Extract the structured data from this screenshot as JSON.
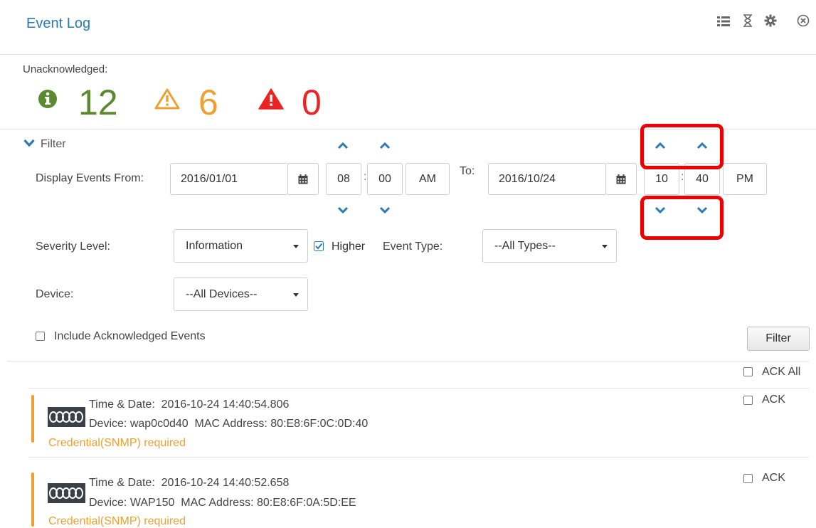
{
  "header": {
    "title": "Event Log",
    "icons": [
      "list-icon",
      "hourglass-icon",
      "gear-icon",
      "close-icon"
    ]
  },
  "unacknowledged": {
    "label": "Unacknowledged:",
    "info_count": "12",
    "warning_count": "6",
    "alert_count": "0",
    "colors": {
      "info": "#5a8a2f",
      "warning": "#f0a030",
      "alert": "#ee2222"
    }
  },
  "filter": {
    "toggle_label": "Filter",
    "from_label": "Display Events From:",
    "from_date": "2016/01/01",
    "from_hour": "08",
    "from_minute": "00",
    "from_ampm": "AM",
    "to_label": "To:",
    "to_date": "2016/10/24",
    "to_hour": "10",
    "to_minute": "40",
    "to_ampm": "PM",
    "severity_label": "Severity Level:",
    "severity_value": "Information",
    "higher_label": "Higher",
    "higher_checked": true,
    "event_type_label": "Event Type:",
    "event_type_value": "--All Types--",
    "device_label": "Device:",
    "device_value": "--All Devices--",
    "include_ack_label": "Include Acknowledged Events",
    "filter_button": "Filter"
  },
  "list": {
    "ack_all_label": "ACK All",
    "events": [
      {
        "time_label": "Time & Date:",
        "time": "2016-10-24 14:40:54.806",
        "device_label": "Device:",
        "device": "wap0c0d40",
        "mac_label": "MAC Address:",
        "mac": "80:E8:6F:0C:0D:40",
        "status": "Credential(SNMP) required",
        "ack_label": "ACK"
      },
      {
        "time_label": "Time & Date:",
        "time": "2016-10-24 14:40:52.658",
        "device_label": "Device:",
        "device": "WAP150",
        "mac_label": "MAC Address:",
        "mac": "80:E8:6F:0A:5D:EE",
        "status": "Credential(SNMP) required",
        "ack_label": "ACK"
      }
    ]
  }
}
